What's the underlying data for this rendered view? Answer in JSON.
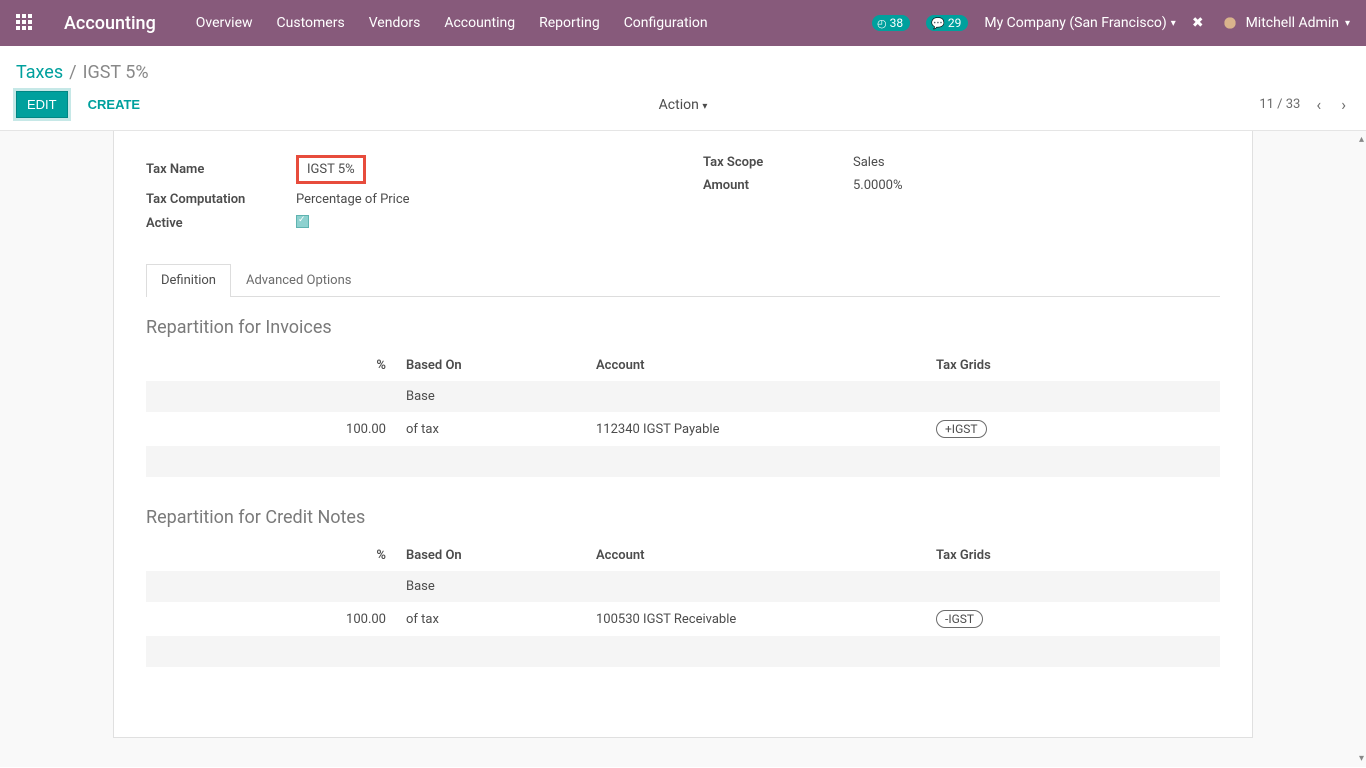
{
  "navbar": {
    "brand": "Accounting",
    "menu": [
      "Overview",
      "Customers",
      "Vendors",
      "Accounting",
      "Reporting",
      "Configuration"
    ],
    "badge1_count": "38",
    "badge2_count": "29",
    "company": "My Company (San Francisco)",
    "user": "Mitchell Admin"
  },
  "breadcrumb": {
    "parent": "Taxes",
    "current": "IGST 5%"
  },
  "controls": {
    "edit": "EDIT",
    "create": "CREATE",
    "action": "Action",
    "pager": "11 / 33"
  },
  "form": {
    "tax_name_label": "Tax Name",
    "tax_name_value": "IGST 5%",
    "tax_comp_label": "Tax Computation",
    "tax_comp_value": "Percentage of Price",
    "active_label": "Active",
    "scope_label": "Tax Scope",
    "scope_value": "Sales",
    "amount_label": "Amount",
    "amount_value": "5.0000%"
  },
  "tabs": {
    "definition": "Definition",
    "advanced": "Advanced Options"
  },
  "invoices": {
    "title": "Repartition for Invoices",
    "headers": {
      "pct": "%",
      "based": "Based On",
      "account": "Account",
      "grids": "Tax Grids"
    },
    "rows": [
      {
        "pct": "",
        "based": "Base",
        "account": "",
        "grids": ""
      },
      {
        "pct": "100.00",
        "based": "of tax",
        "account": "112340 IGST Payable",
        "grids": "+IGST"
      }
    ]
  },
  "credits": {
    "title": "Repartition for Credit Notes",
    "headers": {
      "pct": "%",
      "based": "Based On",
      "account": "Account",
      "grids": "Tax Grids"
    },
    "rows": [
      {
        "pct": "",
        "based": "Base",
        "account": "",
        "grids": ""
      },
      {
        "pct": "100.00",
        "based": "of tax",
        "account": "100530 IGST Receivable",
        "grids": "-IGST"
      }
    ]
  }
}
